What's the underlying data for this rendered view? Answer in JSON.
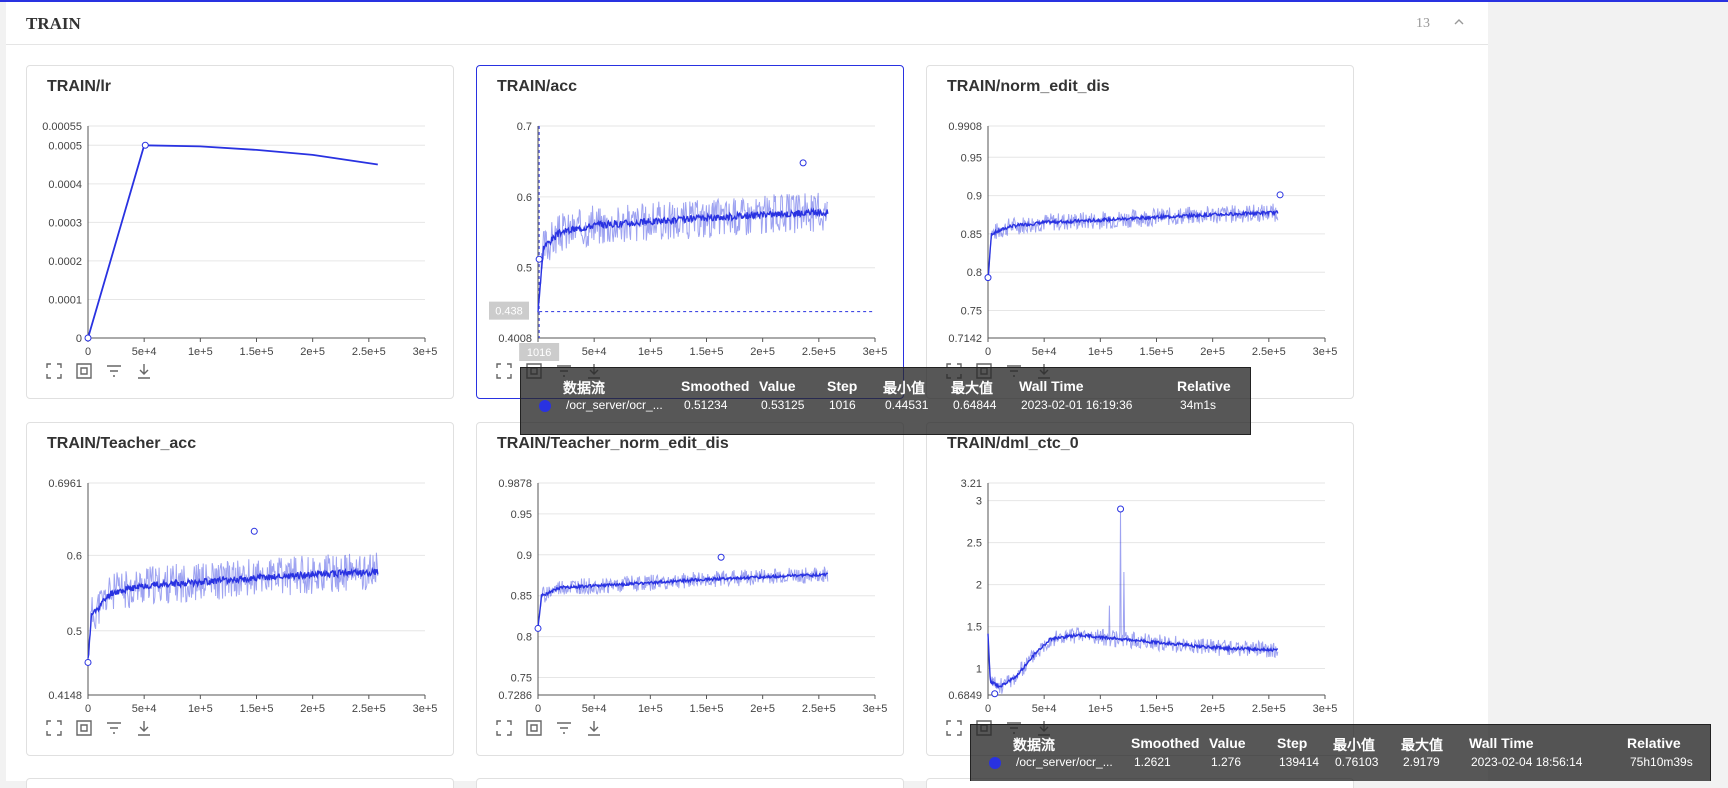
{
  "section": {
    "title": "TRAIN",
    "count": "13"
  },
  "colors": {
    "series": "#2932e1",
    "accent": "#2932e1",
    "grid": "#e6e6e6"
  },
  "chart_data": [
    {
      "type": "line",
      "title": "TRAIN/lr",
      "ylim": [
        0,
        0.00055
      ],
      "xlim": [
        0,
        300000
      ],
      "yticks": [
        "0",
        "0.0001",
        "0.0002",
        "0.0003",
        "0.0004",
        "0.0005",
        "0.00055"
      ],
      "ytick_values": [
        0,
        0.0001,
        0.0002,
        0.0003,
        0.0004,
        0.0005,
        0.00055
      ],
      "xticks": [
        "0",
        "5e+4",
        "1e+5",
        "1.5e+5",
        "2e+5",
        "2.5e+5",
        "3e+5"
      ],
      "series": [
        {
          "x": [
            0,
            50000,
            100000,
            150000,
            200000,
            258000
          ],
          "y": [
            0,
            0.0005,
            0.000497,
            0.000488,
            0.000475,
            0.00045
          ]
        }
      ],
      "markers": [
        {
          "x": 0,
          "y": 0
        },
        {
          "x": 51000,
          "y": 0.0005
        }
      ]
    },
    {
      "type": "line",
      "title": "TRAIN/acc",
      "ylim": [
        0.4008,
        0.7
      ],
      "xlim": [
        0,
        300000
      ],
      "active": true,
      "yticks": [
        "0.4008",
        "0.5",
        "0.6",
        "0.7"
      ],
      "ytick_values": [
        0.4008,
        0.5,
        0.6,
        0.7
      ],
      "xticks": [
        "0",
        "5e+4",
        "1e+5",
        "1.5e+5",
        "2e+5",
        "2.5e+5",
        "3e+5"
      ],
      "series": [
        {
          "x": [
            0,
            5000,
            20000,
            50000,
            100000,
            150000,
            200000,
            258000
          ],
          "y": [
            0.44,
            0.53,
            0.55,
            0.56,
            0.565,
            0.57,
            0.575,
            0.578
          ],
          "noise": 0.028,
          "seed": 3
        }
      ],
      "markers": [
        {
          "x": 1016,
          "y": 0.512
        },
        {
          "x": 236000,
          "y": 0.648
        }
      ],
      "crosshair": {
        "x": 1016,
        "y": 0.438,
        "xlabel": "1016",
        "ylabel": "0.438"
      }
    },
    {
      "type": "line",
      "title": "TRAIN/norm_edit_dis",
      "ylim": [
        0.7142,
        0.9908
      ],
      "xlim": [
        0,
        300000
      ],
      "yticks": [
        "0.7142",
        "0.75",
        "0.8",
        "0.85",
        "0.9",
        "0.95",
        "0.9908"
      ],
      "ytick_values": [
        0.7142,
        0.75,
        0.8,
        0.85,
        0.9,
        0.95,
        0.9908
      ],
      "xticks": [
        "0",
        "5e+4",
        "1e+5",
        "1.5e+5",
        "2e+5",
        "2.5e+5",
        "3e+5"
      ],
      "series": [
        {
          "x": [
            0,
            3000,
            20000,
            50000,
            100000,
            150000,
            200000,
            258000
          ],
          "y": [
            0.79,
            0.85,
            0.86,
            0.865,
            0.868,
            0.872,
            0.875,
            0.878
          ],
          "noise": 0.012,
          "seed": 7
        }
      ],
      "markers": [
        {
          "x": 0,
          "y": 0.793
        },
        {
          "x": 260000,
          "y": 0.901
        }
      ]
    },
    {
      "type": "line",
      "title": "TRAIN/Teacher_acc",
      "ylim": [
        0.4148,
        0.6961
      ],
      "xlim": [
        0,
        300000
      ],
      "yticks": [
        "0.4148",
        "0.5",
        "0.6",
        "0.6961"
      ],
      "ytick_values": [
        0.4148,
        0.5,
        0.6,
        0.6961
      ],
      "xticks": [
        "0",
        "5e+4",
        "1e+5",
        "1.5e+5",
        "2e+5",
        "2.5e+5",
        "3e+5"
      ],
      "series": [
        {
          "x": [
            0,
            3000,
            20000,
            50000,
            100000,
            150000,
            200000,
            258000
          ],
          "y": [
            0.46,
            0.52,
            0.55,
            0.56,
            0.565,
            0.57,
            0.575,
            0.578
          ],
          "noise": 0.026,
          "seed": 11
        }
      ],
      "markers": [
        {
          "x": 0,
          "y": 0.458
        },
        {
          "x": 148000,
          "y": 0.632
        }
      ]
    },
    {
      "type": "line",
      "title": "TRAIN/Teacher_norm_edit_dis",
      "ylim": [
        0.7286,
        0.9878
      ],
      "xlim": [
        0,
        300000
      ],
      "yticks": [
        "0.7286",
        "0.75",
        "0.8",
        "0.85",
        "0.9",
        "0.95",
        "0.9878"
      ],
      "ytick_values": [
        0.7286,
        0.75,
        0.8,
        0.85,
        0.9,
        0.95,
        0.9878
      ],
      "xticks": [
        "0",
        "5e+4",
        "1e+5",
        "1.5e+5",
        "2e+5",
        "2.5e+5",
        "3e+5"
      ],
      "series": [
        {
          "x": [
            0,
            3000,
            20000,
            50000,
            100000,
            150000,
            200000,
            258000
          ],
          "y": [
            0.81,
            0.85,
            0.86,
            0.862,
            0.866,
            0.87,
            0.873,
            0.876
          ],
          "noise": 0.01,
          "seed": 19
        }
      ],
      "markers": [
        {
          "x": 0,
          "y": 0.81
        },
        {
          "x": 163000,
          "y": 0.897
        }
      ]
    },
    {
      "type": "line",
      "title": "TRAIN/dml_ctc_0",
      "ylim": [
        0.6849,
        3.21
      ],
      "xlim": [
        0,
        300000
      ],
      "yticks": [
        "0.6849",
        "1",
        "1.5",
        "2",
        "2.5",
        "3",
        "3.21"
      ],
      "ytick_values": [
        0.6849,
        1,
        1.5,
        2,
        2.5,
        3,
        3.21
      ],
      "xticks": [
        "0",
        "5e+4",
        "1e+5",
        "1.5e+5",
        "2e+5",
        "2.5e+5",
        "3e+5"
      ],
      "series": [
        {
          "x": [
            0,
            2000,
            10000,
            25000,
            40000,
            55000,
            80000,
            120000,
            160000,
            200000,
            258000
          ],
          "y": [
            1.4,
            0.85,
            0.78,
            0.9,
            1.15,
            1.35,
            1.4,
            1.35,
            1.3,
            1.25,
            1.22
          ],
          "noise": 0.1,
          "seed": 23,
          "spikes": [
            {
              "x": 118000,
              "y": 2.9
            },
            {
              "x": 121000,
              "y": 2.15
            },
            {
              "x": 108000,
              "y": 1.75
            }
          ]
        }
      ],
      "markers": [
        {
          "x": 6000,
          "y": 0.7
        },
        {
          "x": 118000,
          "y": 2.9
        }
      ]
    }
  ],
  "tooltips": [
    {
      "headers": [
        "数据流",
        "Smoothed",
        "Value",
        "Step",
        "最小值",
        "最大值",
        "Wall Time",
        "Relative"
      ],
      "values": [
        "/ocr_server/ocr_...",
        "0.51234",
        "0.53125",
        "1016",
        "0.44531",
        "0.64844",
        "2023-02-01 16:19:36",
        "34m1s"
      ]
    },
    {
      "headers": [
        "数据流",
        "Smoothed",
        "Value",
        "Step",
        "最小值",
        "最大值",
        "Wall Time",
        "Relative"
      ],
      "values": [
        "/ocr_server/ocr_...",
        "1.2621",
        "1.276",
        "139414",
        "0.76103",
        "2.9179",
        "2023-02-04 18:56:14",
        "75h10m39s"
      ]
    }
  ]
}
